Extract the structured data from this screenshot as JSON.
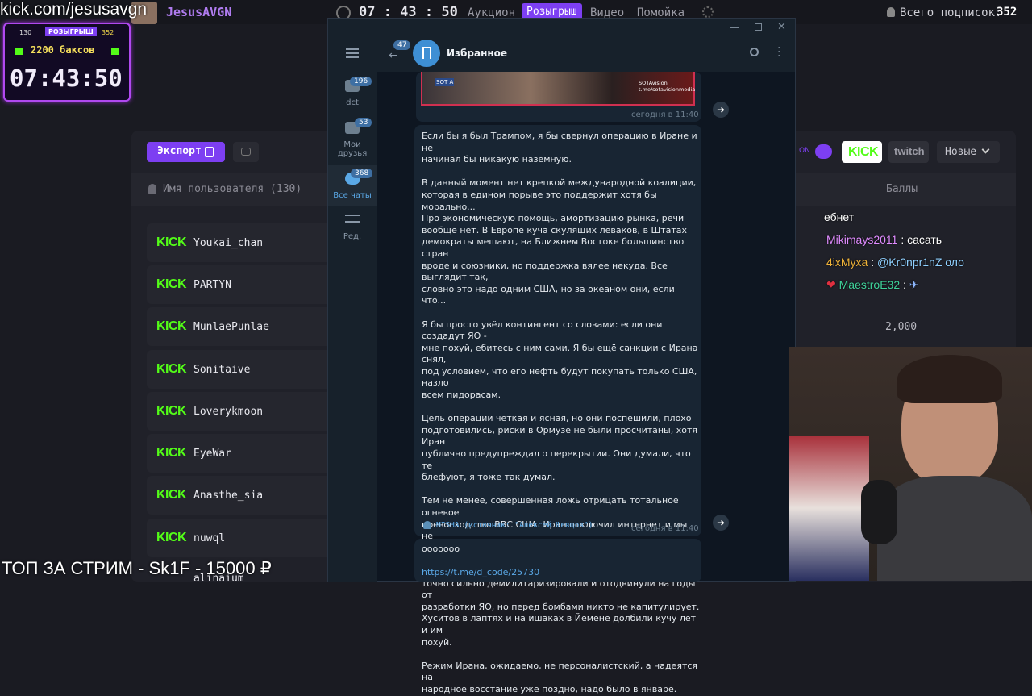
{
  "topbar": {
    "url": "kick.com/jesusavgn",
    "channel_name": "JesusAVGN",
    "timer": "07 : 43 : 50",
    "tabs": [
      "Аукцион",
      "Розыгрыш",
      "Видео",
      "Помойка"
    ],
    "active_tab": "Розыгрыш",
    "subs_label": "Всего подписок:",
    "subs_count": "352"
  },
  "giveaway": {
    "left_count": "130",
    "title": "РОЗЫГРЫШ",
    "right_count": "352",
    "prize": "2200 баксов",
    "timer": "07:43:50"
  },
  "page": {
    "export_label": "Экспорт",
    "user_col": "Имя пользователя (130)",
    "points_col": "Баллы",
    "toggle_label": "ON",
    "kick_label": "KICK",
    "twitch_label": "twitch",
    "sort_label": "Новые",
    "points_value": "2,000",
    "users": [
      "Youkai_chan",
      "PARTYN",
      "MunlaePunlae",
      "Sonitaive",
      "Loverykmoon",
      "EyeWar",
      "Anasthe_sia",
      "nuwql"
    ],
    "partial_user": "alinaium"
  },
  "telegram": {
    "chat_title": "Избранное",
    "back_badge": "47",
    "sidebar": [
      {
        "label": "dct",
        "badge": "196"
      },
      {
        "label": "Мои друзья",
        "badge": "53"
      },
      {
        "label": "Все чаты",
        "badge": "368"
      },
      {
        "label": "Ред.",
        "badge": ""
      }
    ],
    "image_caption_left": "SOT A",
    "image_caption_right": "SOTAvision\nt.me/sotavisionmedia",
    "time1": "сегодня в 11:40",
    "message": "Если бы я был Трампом, я бы свернул операцию в Иране и не\nначинал бы никакую наземную.\n\nВ данный момент нет крепкой международной коалиции,\nкоторая в едином порыве это поддержит хотя бы морально...\nПро экономическую помощь, амортизацию рынка, речи\nвообще нет. В Европе куча скулящих леваков, в Штатах\nдемократы мешают, на Ближнем Востоке большинство стран\nвроде и союзники, но поддержка вялее некуда. Все выглядит так,\nсловно это надо одним США, но за океаном они, если что...\n\nЯ бы просто увёл контингент со словами: если они создадут ЯО -\nмне похуй, ебитесь с ним сами. Я бы ещё санкции с Ирана снял,\nпод условием, что его нефть будут покупать только США, назло\nвсем пидорасам.\n\nЦель операции чёткая и ясная, но они поспешили, плохо\nподготовились, риски в Ормузе не были просчитаны, хотя Иран\nпублично предупреждал о перекрытии. Они думали, что те\nблефуют, я тоже так думал.\n\nТем не менее, совершенная ложь отрицать тотальное огневое\nпревосходство ВВС США. Иран отключил интернет и мы не\nвидим, что там происходит до конца. Но точно ясно, что в\nпервые минуты убили буквально всё руководство, совершенно\nточно сильно демилитаризировали и отодвинули на годы от\nразработки ЯО, но перед бомбами никто не капитулирует.\nХуситов в лаптях и на ишаках в Йемене долбили кучу лет и им\nпохуй.\n\nРежим Ирана, ожидаемо, не персоналистский, а надеятся на\nнародное восстание уже поздно, надо было в январе.",
    "signature": "MISHA (источник: \"Алексей Шевцов\")",
    "time2": "сегодня в 11:40",
    "msg2": "ооооооо",
    "link": "https://t.me/d_code/25730"
  },
  "chat": [
    {
      "user": "",
      "text": "ебнет",
      "color": "#ffffff"
    },
    {
      "user": "Mikimays2011",
      "text": "сасать",
      "color": "#e08cff"
    },
    {
      "user": "4ixMyxa",
      "text": "@Kr0npr1nZ оло",
      "color": "#f2b53a"
    },
    {
      "user": "MaestroE32",
      "text": "",
      "color": "#3fd29a"
    }
  ],
  "overlay": {
    "bottom_text": "ТОП ЗА СТРИМ - Sk1F - 15000 ₽"
  },
  "colors": {
    "accent_purple": "#7d3ff2",
    "kick_green": "#53fc18",
    "telegram_bg": "#0e1621",
    "telegram_bubble": "#182533"
  }
}
